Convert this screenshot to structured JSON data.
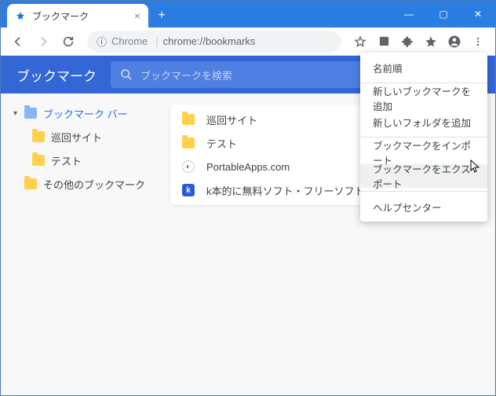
{
  "window": {
    "tab_title": "ブックマーク",
    "min": "—",
    "max": "▢",
    "close": "✕"
  },
  "toolbar": {
    "addr_proto_icon": "ⓘ",
    "addr_host": "Chrome",
    "addr_sep": "|",
    "addr_path": "chrome://bookmarks"
  },
  "page": {
    "title": "ブックマーク",
    "search_placeholder": "ブックマークを検索"
  },
  "sidebar": {
    "root": "ブックマーク バー",
    "children": [
      "巡回サイト",
      "テスト"
    ],
    "other": "その他のブックマーク"
  },
  "list": {
    "items": [
      {
        "icon": "folder",
        "label": "巡回サイト"
      },
      {
        "icon": "folder",
        "label": "テスト"
      },
      {
        "icon": "pa",
        "label": "PortableApps.com"
      },
      {
        "icon": "k",
        "label": "k本的に無料ソフト・フリーソフト"
      }
    ]
  },
  "menu": {
    "sort": "名前順",
    "add_bookmark": "新しいブックマークを追加",
    "add_folder": "新しいフォルダを追加",
    "import": "ブックマークをインポート",
    "export": "ブックマークをエクスポート",
    "help": "ヘルプセンター"
  }
}
